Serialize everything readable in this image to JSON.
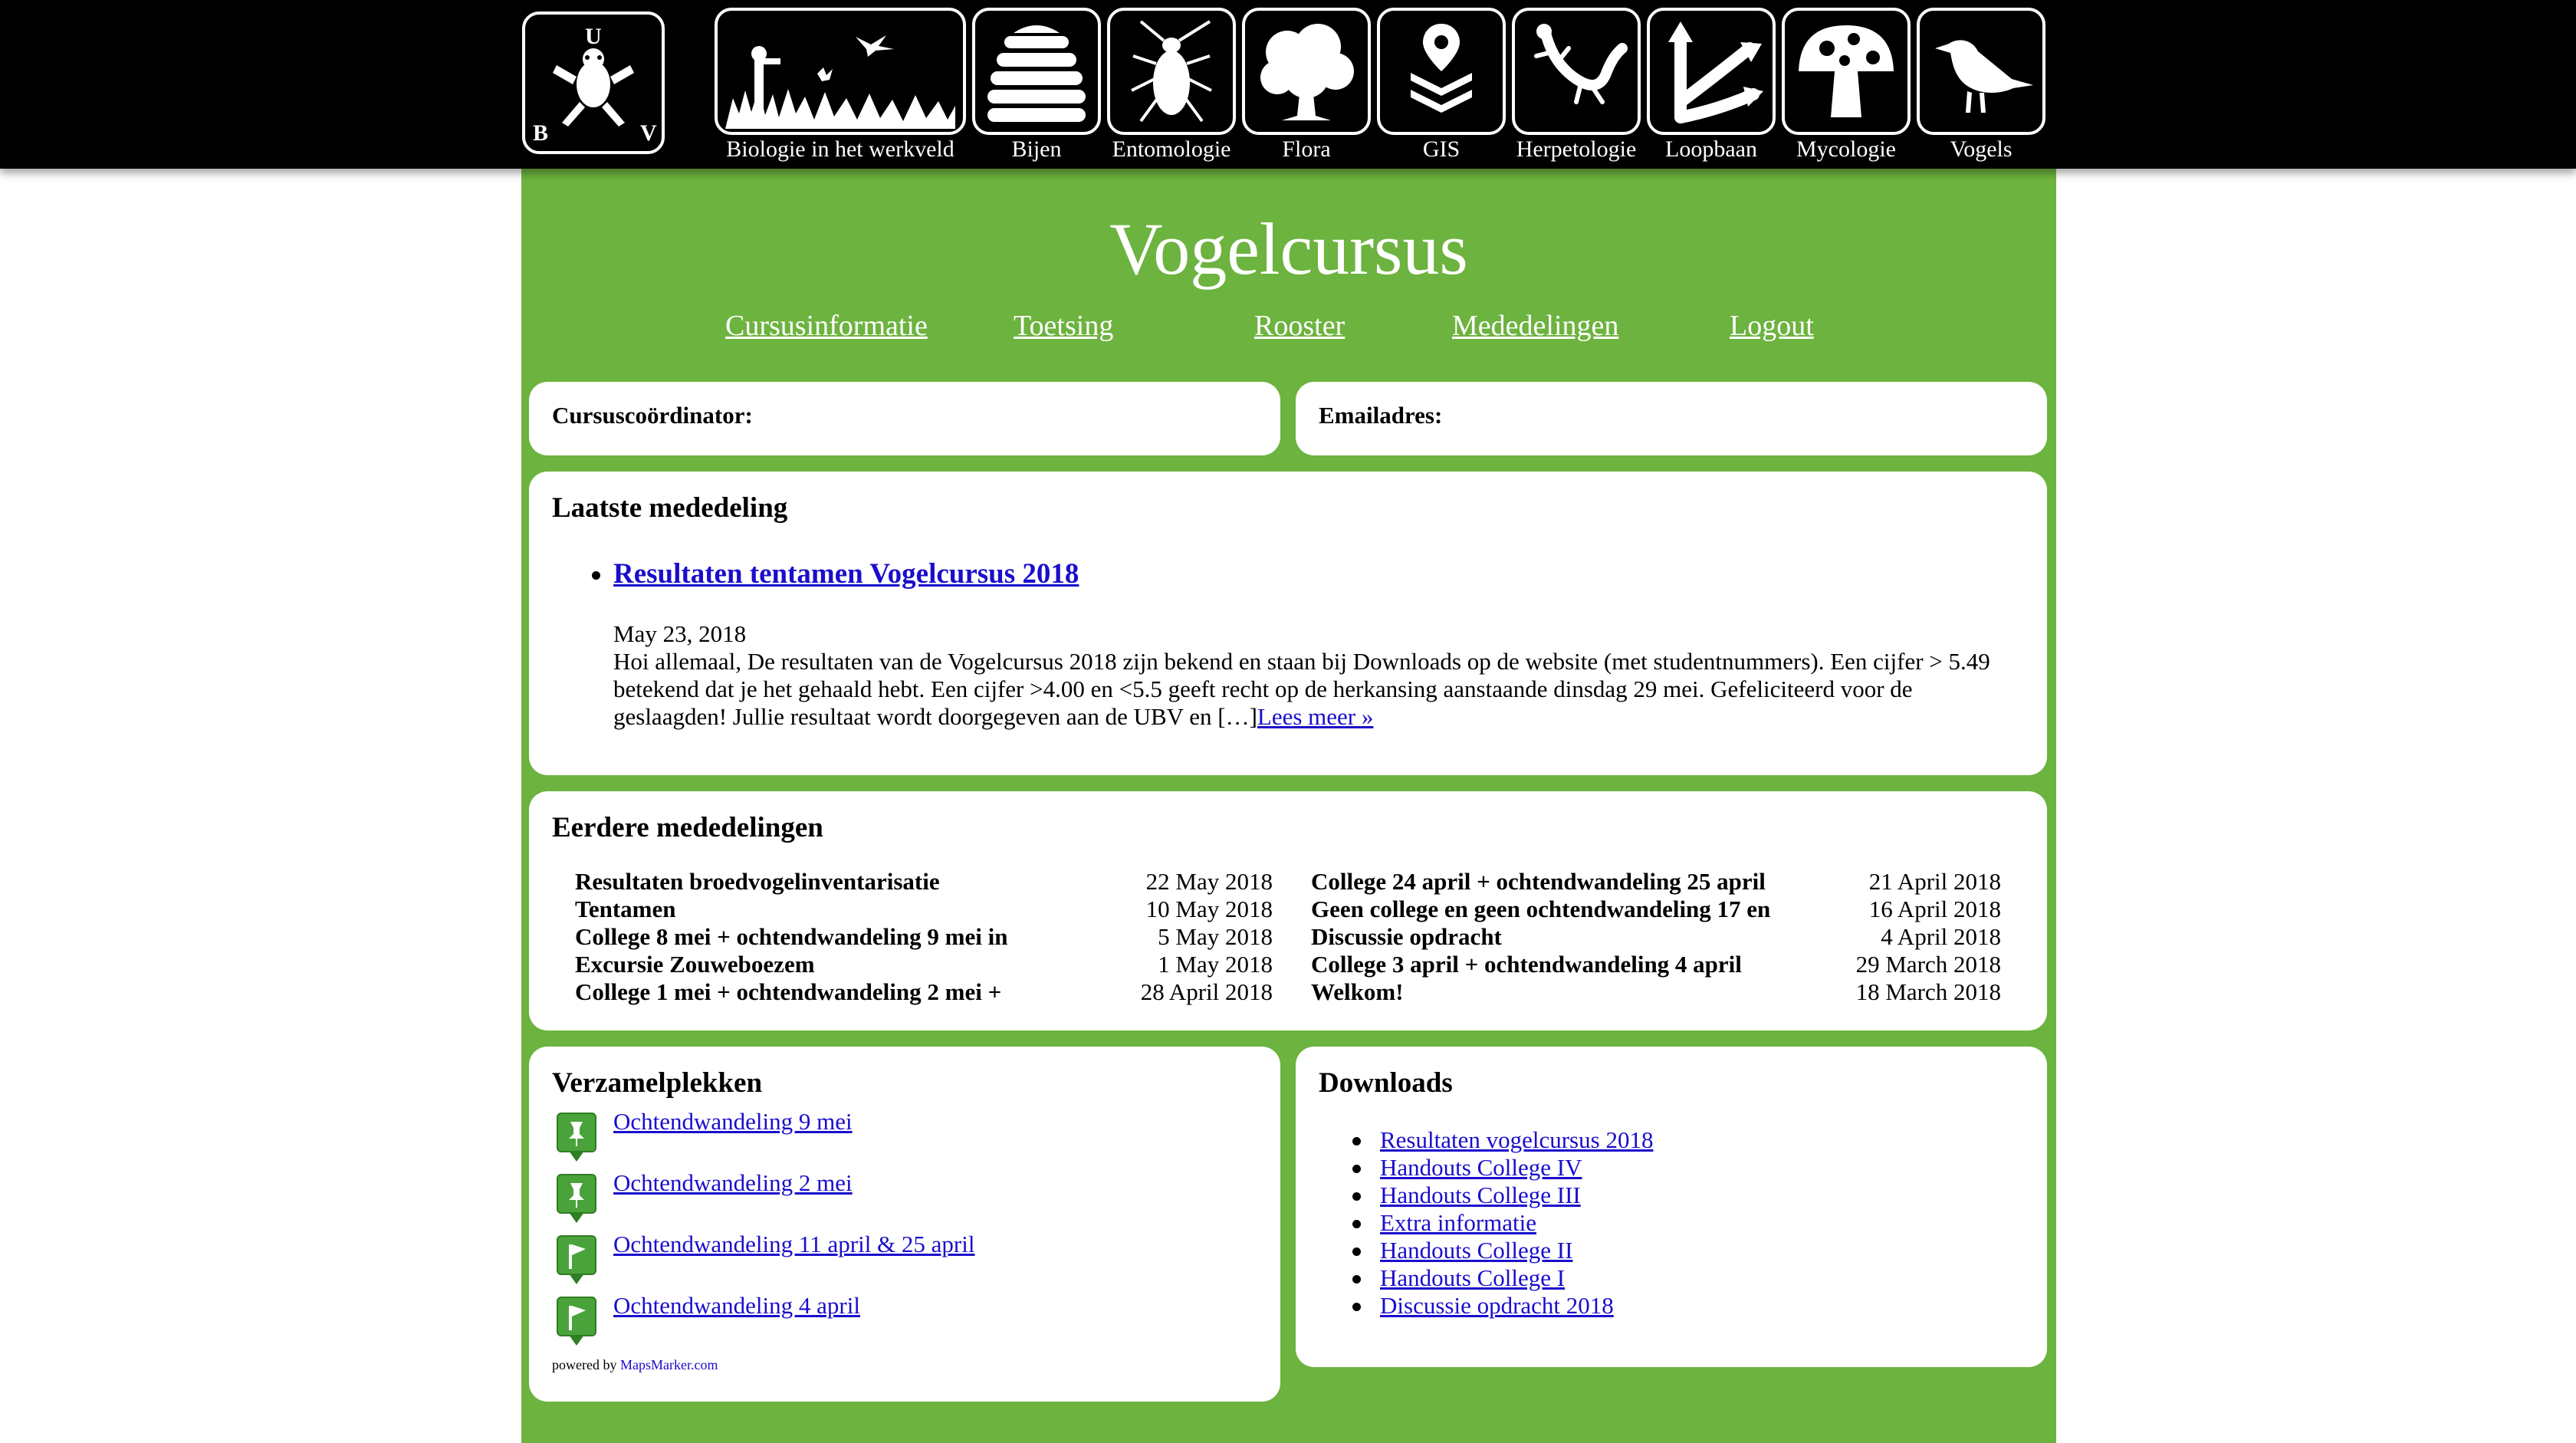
{
  "logo": {
    "letters": [
      "U",
      "B",
      "V"
    ]
  },
  "categories": [
    {
      "label": "Biologie in het werkveld",
      "icon": "field-birdwatcher-icon"
    },
    {
      "label": "Bijen",
      "icon": "beehive-icon"
    },
    {
      "label": "Entomologie",
      "icon": "insect-icon"
    },
    {
      "label": "Flora",
      "icon": "tree-icon"
    },
    {
      "label": "GIS",
      "icon": "map-layers-icon"
    },
    {
      "label": "Herpetologie",
      "icon": "lizard-icon"
    },
    {
      "label": "Loopbaan",
      "icon": "career-arrows-icon"
    },
    {
      "label": "Mycologie",
      "icon": "mushroom-icon"
    },
    {
      "label": "Vogels",
      "icon": "bird-icon"
    }
  ],
  "site": {
    "title": "Vogelcursus"
  },
  "nav": [
    "Cursusinformatie",
    "Toetsing",
    "Rooster",
    "Mededelingen",
    "Logout"
  ],
  "info": {
    "coordinator_label": "Cursuscoördinator:",
    "coordinator_value": "",
    "email_label": "Emailadres:",
    "email_value": ""
  },
  "latest": {
    "heading": "Laatste mededeling",
    "title": "Resultaten tentamen Vogelcursus 2018",
    "date": "May 23, 2018",
    "body": "Hoi allemaal, De resultaten van de Vogelcursus 2018 zijn bekend en staan bij Downloads op de website (met studentnummers). Een cijfer > 5.49 betekend dat je het gehaald hebt. Een cijfer >4.00 en <5.5 geeft recht op de herkansing aanstaande dinsdag 29 mei. Gefeliciteerd voor de geslaagden! Jullie resultaat wordt doorgegeven aan de UBV en […]",
    "read_more": "Lees meer »"
  },
  "previous": {
    "heading": "Eerdere mededelingen",
    "left": [
      {
        "title": "Resultaten broedvogelinventarisatie",
        "date": "22 May 2018"
      },
      {
        "title": "Tentamen",
        "date": "10 May 2018"
      },
      {
        "title": "College 8 mei + ochtendwandeling 9 mei in",
        "date": "5 May 2018"
      },
      {
        "title": "Excursie Zouweboezem",
        "date": "1 May 2018"
      },
      {
        "title": "College 1 mei + ochtendwandeling 2 mei +",
        "date": "28 April 2018"
      }
    ],
    "right": [
      {
        "title": "College 24 april + ochtendwandeling 25 april",
        "date": "21 April 2018"
      },
      {
        "title": "Geen college en geen ochtendwandeling 17 en",
        "date": "16 April 2018"
      },
      {
        "title": "Discussie opdracht",
        "date": "4 April 2018"
      },
      {
        "title": "College 3 april + ochtendwandeling 4 april",
        "date": "29 March 2018"
      },
      {
        "title": "Welkom!",
        "date": "18 March 2018"
      }
    ]
  },
  "locations": {
    "heading": "Verzamelplekken",
    "items": [
      {
        "label": "Ochtendwandeling 9 mei",
        "icon": "pin-marker-icon"
      },
      {
        "label": "Ochtendwandeling 2 mei",
        "icon": "pin-marker-icon"
      },
      {
        "label": "Ochtendwandeling 11 april & 25 april",
        "icon": "flag-marker-icon"
      },
      {
        "label": "Ochtendwandeling 4 april",
        "icon": "flag-marker-icon"
      }
    ],
    "powered_prefix": "powered by",
    "powered_link": "MapsMarker.com"
  },
  "downloads": {
    "heading": "Downloads",
    "items": [
      "Resultaten vogelcursus 2018",
      "Handouts College IV",
      "Handouts College III",
      "Extra informatie",
      "Handouts College II",
      "Handouts College I",
      "Discussie opdracht 2018"
    ]
  }
}
